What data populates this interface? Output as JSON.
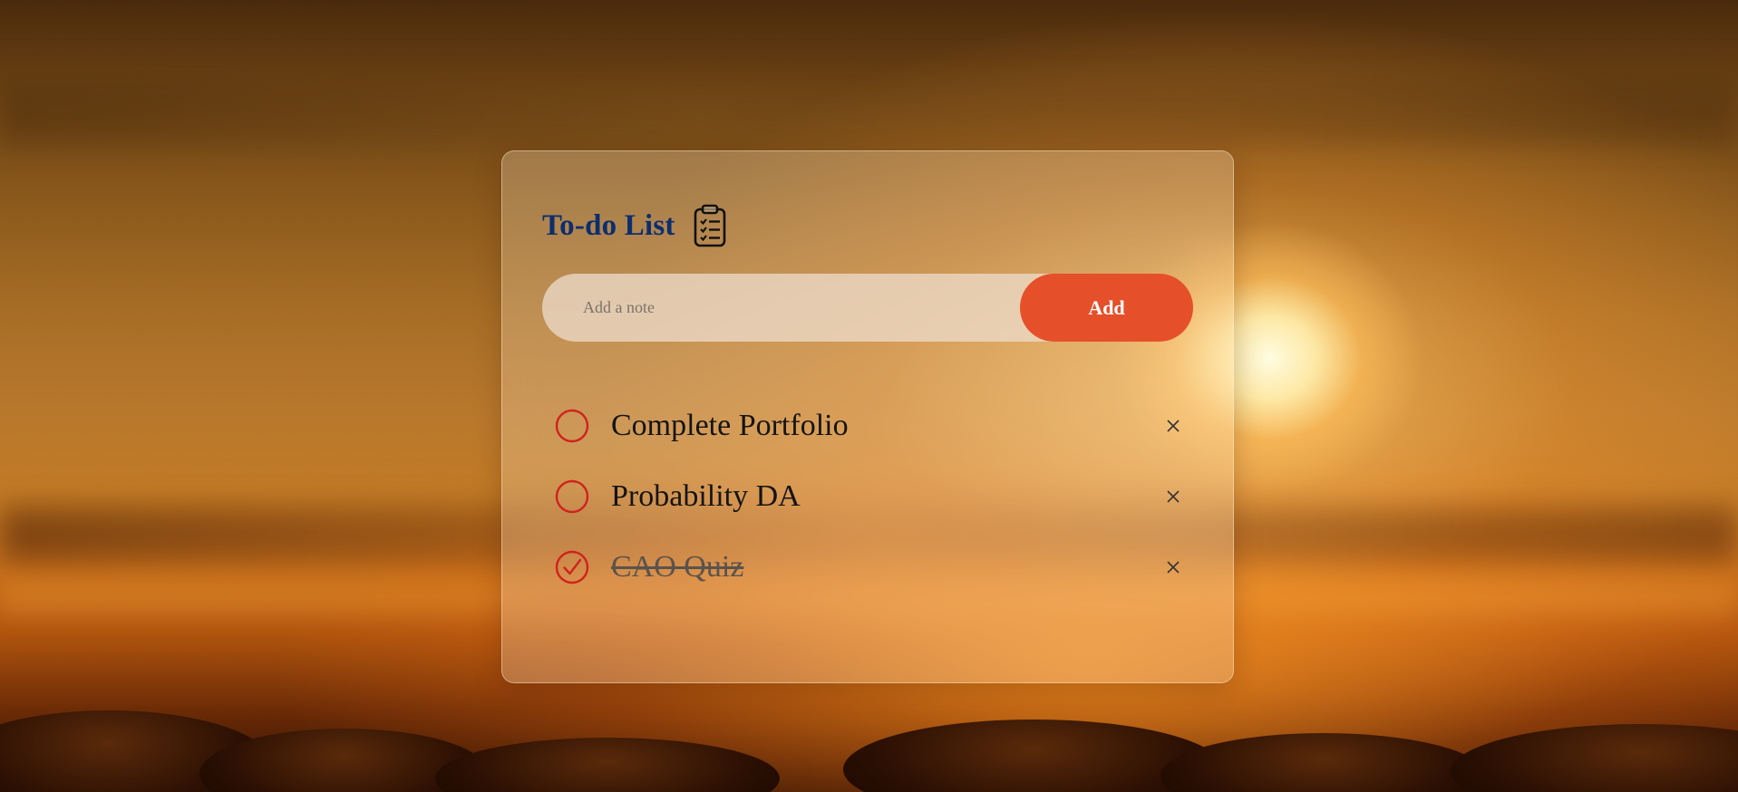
{
  "app": {
    "title": "To-do List"
  },
  "input": {
    "placeholder": "Add a note",
    "value": ""
  },
  "add_button": {
    "label": "Add"
  },
  "todos": [
    {
      "text": "Complete Portfolio",
      "done": false
    },
    {
      "text": "Probability DA",
      "done": false
    },
    {
      "text": "CAO Quiz",
      "done": true
    }
  ],
  "icons": {
    "title_icon": "clipboard-checklist-icon",
    "unchecked": "circle-icon",
    "checked": "check-circle-icon",
    "delete": "close-icon"
  },
  "colors": {
    "title": "#0d2e6e",
    "accent": "#e5502b",
    "checkbox": "#d0221f",
    "text": "#141414"
  }
}
